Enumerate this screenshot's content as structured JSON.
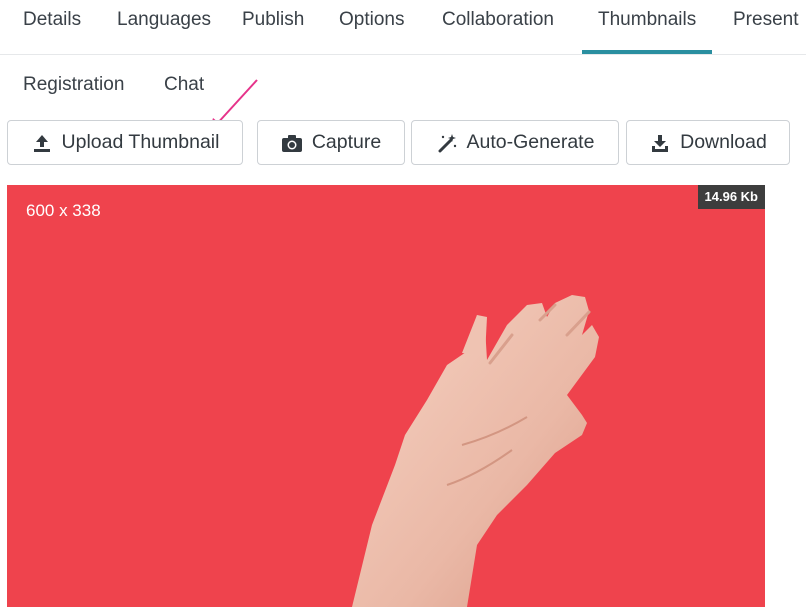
{
  "tabs_row1": [
    {
      "label": "Details"
    },
    {
      "label": "Languages"
    },
    {
      "label": "Publish"
    },
    {
      "label": "Options"
    },
    {
      "label": "Collaboration"
    },
    {
      "label": "Thumbnails",
      "active": true
    },
    {
      "label": "Present"
    }
  ],
  "tabs_row2": [
    {
      "label": "Registration"
    },
    {
      "label": "Chat"
    }
  ],
  "toolbar": {
    "upload_label": "Upload Thumbnail",
    "capture_label": "Capture",
    "autogen_label": "Auto-Generate",
    "download_label": "Download"
  },
  "preview": {
    "dimensions": "600 x 338",
    "file_size": "14.96 Kb",
    "background_color": "#ef434d"
  },
  "colors": {
    "active_tab_underline": "#2a8fa0",
    "annotation_arrow": "#e6338a"
  },
  "icons": {
    "upload": "upload-icon",
    "capture": "camera-icon",
    "autogen": "magic-wand-icon",
    "download": "download-icon"
  }
}
